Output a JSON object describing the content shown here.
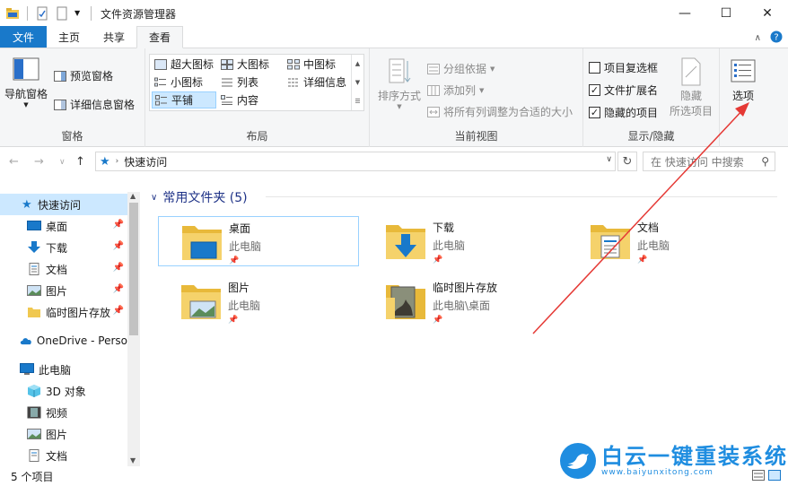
{
  "window": {
    "title": "文件资源管理器",
    "controls": {
      "minimize": "—",
      "maximize": "☐",
      "close": "✕"
    }
  },
  "ribbon": {
    "tabs": [
      {
        "label": "文件"
      },
      {
        "label": "主页"
      },
      {
        "label": "共享"
      },
      {
        "label": "查看"
      }
    ],
    "groups": {
      "panes": {
        "label": "窗格",
        "nav_pane": "导航窗格",
        "preview_pane": "预览窗格",
        "details_pane": "详细信息窗格"
      },
      "layout": {
        "label": "布局",
        "items": [
          "超大图标",
          "大图标",
          "中图标",
          "小图标",
          "列表",
          "详细信息",
          "平铺",
          "内容"
        ],
        "selected": "平铺"
      },
      "current_view": {
        "label": "当前视图",
        "sort_by": "排序方式",
        "group_by": "分组依据",
        "add_columns": "添加列",
        "size_all_columns": "将所有列调整为合适的大小"
      },
      "show_hide": {
        "label": "显示/隐藏",
        "item_checkboxes": {
          "label": "项目复选框",
          "checked": false
        },
        "file_extensions": {
          "label": "文件扩展名",
          "checked": true
        },
        "hidden_items": {
          "label": "隐藏的项目",
          "checked": true
        },
        "hide_selected_line1": "隐藏",
        "hide_selected_line2": "所选项目"
      },
      "options": {
        "label": "选项"
      }
    }
  },
  "navbar": {
    "address": "快速访问",
    "search_placeholder": "在 快速访问 中搜索"
  },
  "nav_pane": {
    "items": [
      {
        "label": "快速访问",
        "icon": "star-icon",
        "pinned": false,
        "selected": true
      },
      {
        "label": "桌面",
        "icon": "desktop-icon",
        "pinned": true
      },
      {
        "label": "下载",
        "icon": "download-icon",
        "pinned": true
      },
      {
        "label": "文档",
        "icon": "document-icon",
        "pinned": true
      },
      {
        "label": "图片",
        "icon": "picture-icon",
        "pinned": true
      },
      {
        "label": "临时图片存放",
        "icon": "folder-icon",
        "pinned": true
      },
      {
        "label": "OneDrive - Perso",
        "icon": "cloud-icon",
        "pinned": false
      },
      {
        "label": "此电脑",
        "icon": "computer-icon",
        "pinned": false
      },
      {
        "label": "3D 对象",
        "icon": "cube-icon",
        "pinned": false
      },
      {
        "label": "视频",
        "icon": "video-icon",
        "pinned": false
      },
      {
        "label": "图片",
        "icon": "picture-icon",
        "pinned": false
      },
      {
        "label": "文档",
        "icon": "document-icon",
        "pinned": false
      }
    ]
  },
  "content": {
    "section_title": "常用文件夹 (5)",
    "folders": [
      {
        "name": "桌面",
        "location": "此电脑",
        "icon": "desktop-folder-icon"
      },
      {
        "name": "下载",
        "location": "此电脑",
        "icon": "downloads-folder-icon"
      },
      {
        "name": "文档",
        "location": "此电脑",
        "icon": "documents-folder-icon"
      },
      {
        "name": "图片",
        "location": "此电脑",
        "icon": "pictures-folder-icon"
      },
      {
        "name": "临时图片存放",
        "location": "此电脑\\桌面",
        "icon": "photo-folder-icon"
      }
    ]
  },
  "statusbar": {
    "count": "5 个项目"
  },
  "watermark": {
    "cn": "白云一键重装系统",
    "en": "www.baiyunxitong.com"
  },
  "colors": {
    "accent": "#1979ca",
    "folder": "#f0c850",
    "annotation": "#e53935",
    "watermark": "#1f8de0"
  }
}
